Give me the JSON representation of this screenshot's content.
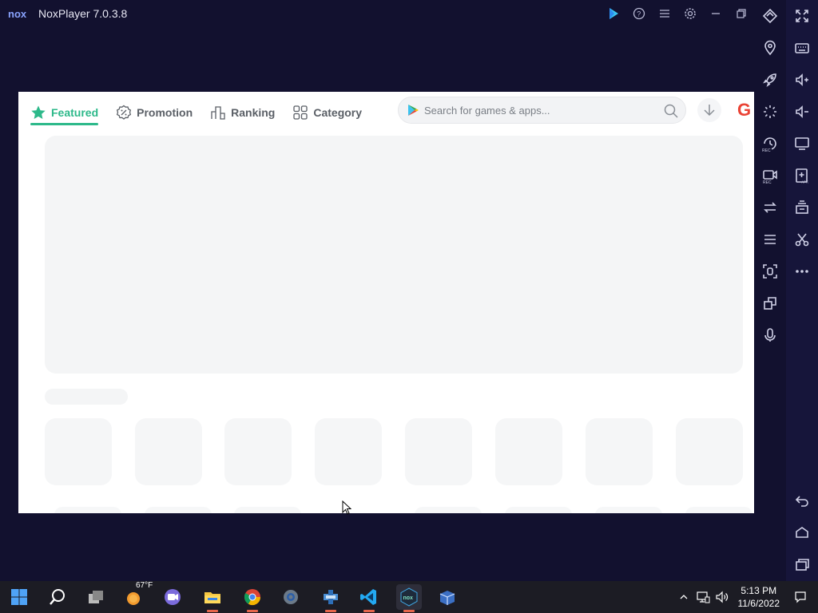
{
  "window": {
    "app_title": "NoxPlayer 7.0.3.8",
    "logo_text": "nox"
  },
  "titlebar_icons": [
    "play-store-icon",
    "help-icon",
    "menu-icon",
    "settings-icon",
    "minimize-icon",
    "restore-icon"
  ],
  "sidebar": {
    "col1": [
      "rotate-icon",
      "location-icon",
      "rocket-icon",
      "loading-icon",
      "record-macro-icon",
      "video-record-icon",
      "sync-icon",
      "menu-icon",
      "screenshot-icon",
      "multi-instance-icon",
      "microphone-icon"
    ],
    "col2": [
      "fullscreen-icon",
      "keyboard-icon",
      "volume-up-icon",
      "volume-down-icon",
      "display-icon",
      "add-apk-icon",
      "shared-folder-icon",
      "cut-icon",
      "more-icon"
    ],
    "bottom": [
      "back-icon",
      "home-icon",
      "recent-apps-icon"
    ]
  },
  "store": {
    "tabs": [
      {
        "label": "Featured",
        "icon": "star-icon",
        "active": true
      },
      {
        "label": "Promotion",
        "icon": "discount-icon",
        "active": false
      },
      {
        "label": "Ranking",
        "icon": "ranking-icon",
        "active": false
      },
      {
        "label": "Category",
        "icon": "grid-icon",
        "active": false
      }
    ],
    "search": {
      "placeholder": "Search for games & apps..."
    },
    "google_letter": "G",
    "accent": "#2db98a"
  },
  "taskbar": {
    "weather": "67°F",
    "time": "5:13 PM",
    "date": "11/6/2022",
    "apps": [
      "windows-start-icon",
      "search-icon",
      "task-view-icon",
      "weather-icon",
      "teams-chat-icon",
      "file-explorer-icon",
      "chrome-icon",
      "settings-icon",
      "app-icon",
      "vscode-icon",
      "noxplayer-icon",
      "app-box-icon"
    ]
  }
}
